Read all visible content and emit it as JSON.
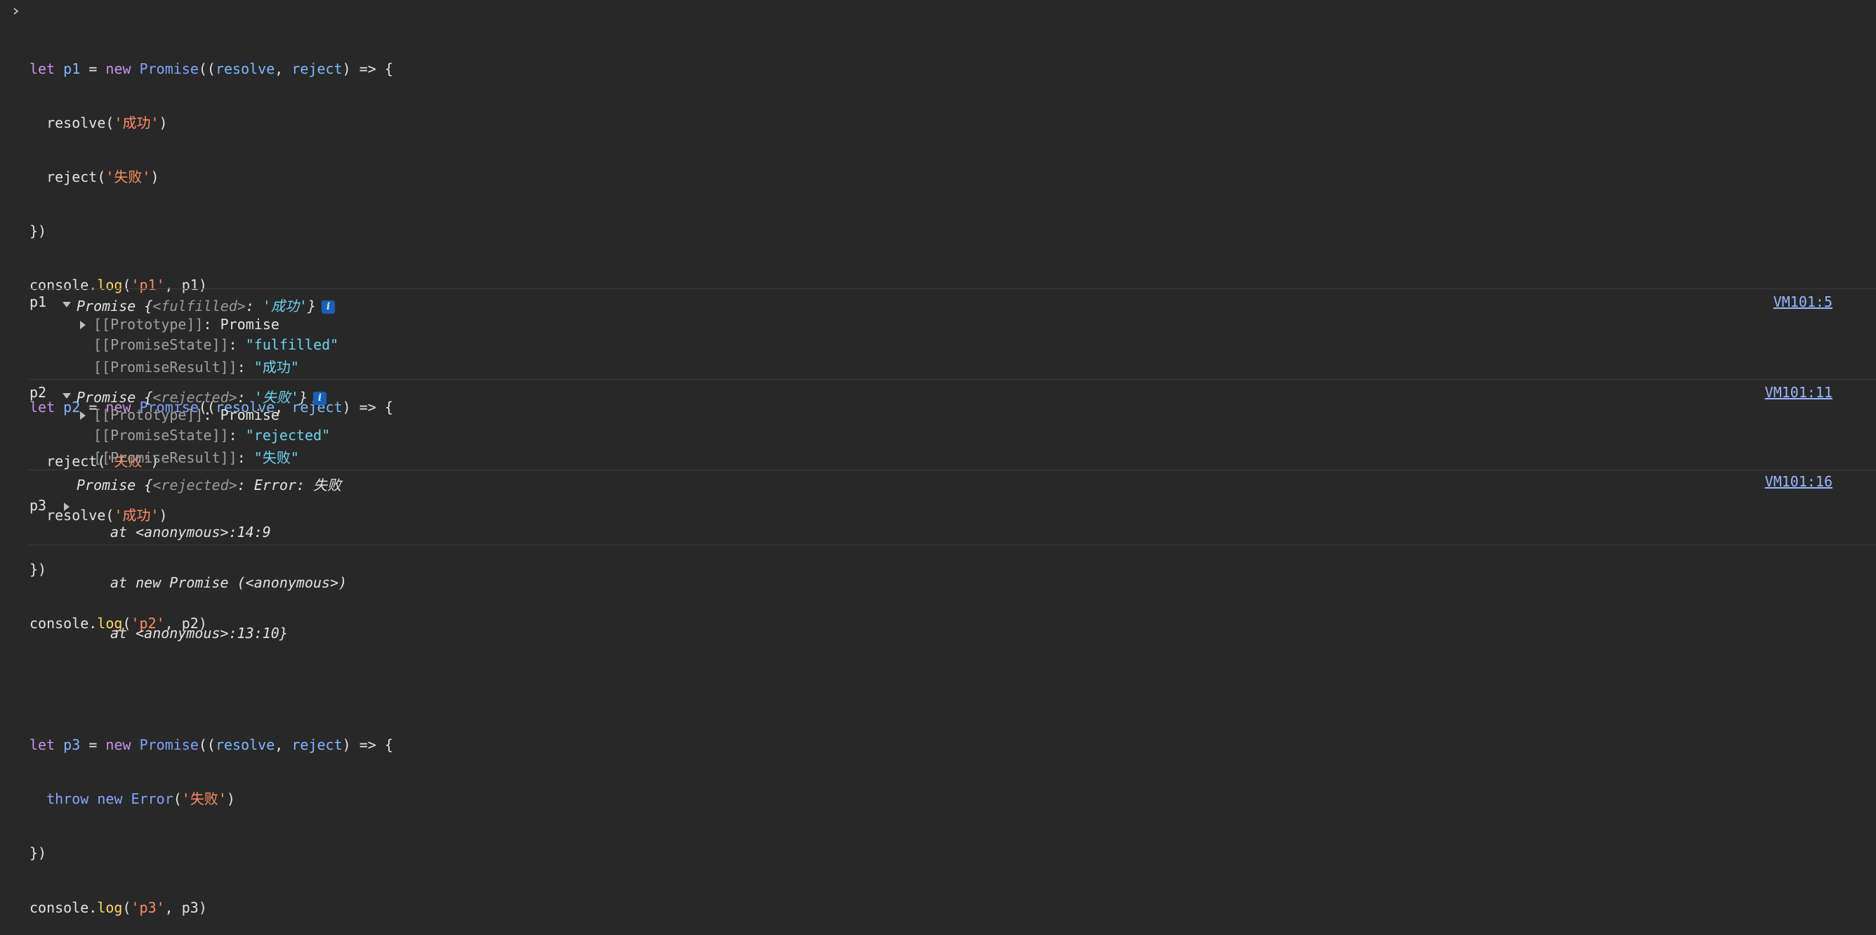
{
  "code": {
    "p1": {
      "line1": [
        "let",
        "p1",
        "=",
        "new",
        "Promise",
        "((",
        "resolve",
        ",",
        "reject",
        ") => {"
      ],
      "l2_fn": "resolve",
      "l2_arg": "'成功'",
      "l3_fn": "reject",
      "l3_arg": "'失败'",
      "close": "})",
      "log_obj": "console.",
      "log_fn": "log",
      "log_arg": "'p1'",
      "log_rest": ", p1)"
    },
    "p2": {
      "line1": [
        "let",
        "p2",
        "=",
        "new",
        "Promise",
        "((",
        "resolve",
        ",",
        "reject",
        ") => {"
      ],
      "l2_fn": "reject",
      "l2_arg": "'失败'",
      "l3_fn": "resolve",
      "l3_arg": "'成功'",
      "close": "})",
      "log_obj": "console.",
      "log_fn": "log",
      "log_arg": "'p2'",
      "log_rest": ", p2)"
    },
    "p3": {
      "line1": [
        "let",
        "p3",
        "=",
        "new",
        "Promise",
        "((",
        "resolve",
        ",",
        "reject",
        ") => {"
      ],
      "throw": "throw",
      "new": "new",
      "err": "Error",
      "arg": "'失败'",
      "close": "})",
      "log_obj": "console.",
      "log_fn": "log",
      "log_arg": "'p3'",
      "log_rest": ", p3)"
    }
  },
  "output": [
    {
      "label": "p1",
      "summary_prefix": "Promise {",
      "summary_key": "<fulfilled>",
      "summary_sep": ": ",
      "summary_val": "'成功'",
      "summary_suffix": "}",
      "info": "i",
      "prototype_key": "[[Prototype]]",
      "prototype_val": "Promise",
      "state_key": "[[PromiseState]]",
      "state_val": "\"fulfilled\"",
      "result_key": "[[PromiseResult]]",
      "result_val": "\"成功\"",
      "source": "VM101:5"
    },
    {
      "label": "p2",
      "summary_prefix": "Promise {",
      "summary_key": "<rejected>",
      "summary_sep": ": ",
      "summary_val": "'失败'",
      "summary_suffix": "}",
      "info": "i",
      "prototype_key": "[[Prototype]]",
      "prototype_val": "Promise",
      "state_key": "[[PromiseState]]",
      "state_val": "\"rejected\"",
      "result_key": "[[PromiseResult]]",
      "result_val": "\"失败\"",
      "source": "VM101:11"
    },
    {
      "label": "p3",
      "summary_prefix": "Promise {",
      "summary_key": "<rejected>",
      "summary_rest": ": Error: 失败",
      "stack": [
        "at <anonymous>:14:9",
        "at new Promise (<anonymous>)",
        "at <anonymous>:13:10}"
      ],
      "source": "VM101:16"
    }
  ]
}
